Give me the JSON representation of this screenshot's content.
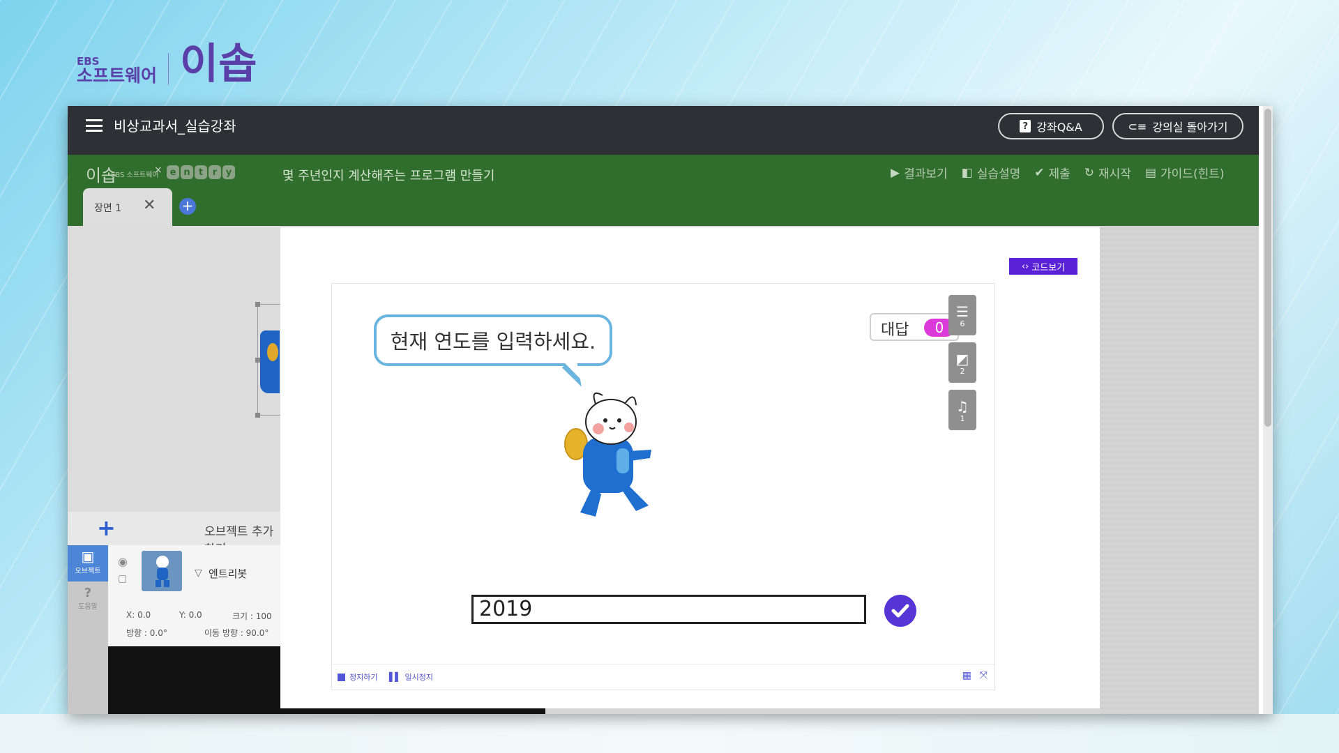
{
  "branding": {
    "ebs": "EBS",
    "software": "소프트웨어",
    "iseum": "이솝"
  },
  "topbar": {
    "course_title": "비상교과서_실습강좌",
    "qa_button": "강좌Q&A",
    "back_button": "강의실 돌아가기"
  },
  "greenbar": {
    "entry_word": [
      "e",
      "n",
      "t",
      "r",
      "y"
    ],
    "lesson_title": "몇 주년인지 계산해주는 프로그램 만들기",
    "tools": [
      {
        "label": "결과보기",
        "icon": "play-icon"
      },
      {
        "label": "실습설명",
        "icon": "book-icon"
      },
      {
        "label": "제출",
        "icon": "check-icon"
      },
      {
        "label": "재시작",
        "icon": "refresh-icon"
      },
      {
        "label": "가이드(힌트)",
        "icon": "clipboard-icon"
      }
    ]
  },
  "scene": {
    "tab_label": "장면 1"
  },
  "objects": {
    "add_label": "오브젝트 추가하기",
    "rail_object": "오브젝트",
    "rail_help": "도움말",
    "item_name": "엔트리봇",
    "x": "X: 0.0",
    "y": "Y: 0.0",
    "size": "크기 : 100",
    "direction": "방향 : 0.0°",
    "move_direction": "이동 방향 : 90.0°"
  },
  "modal": {
    "code_button": "코드보기",
    "speech_bubble": "현재 연도를 입력하세요.",
    "answer_label": "대답",
    "answer_value": "0",
    "resources": [
      {
        "icon": "list-icon",
        "count": "6"
      },
      {
        "icon": "shape-icon",
        "count": "2"
      },
      {
        "icon": "music-icon",
        "count": "1"
      }
    ],
    "input_value": "2019",
    "stop_label": "정지하기",
    "pause_label": "일시정지"
  },
  "colors": {
    "topbar": "#2e3035",
    "greenbar": "#2f6e2c",
    "accent_purple": "#5b21d6",
    "answer_pink": "#dc3ad8",
    "bubble_border": "#6ab4e0"
  }
}
